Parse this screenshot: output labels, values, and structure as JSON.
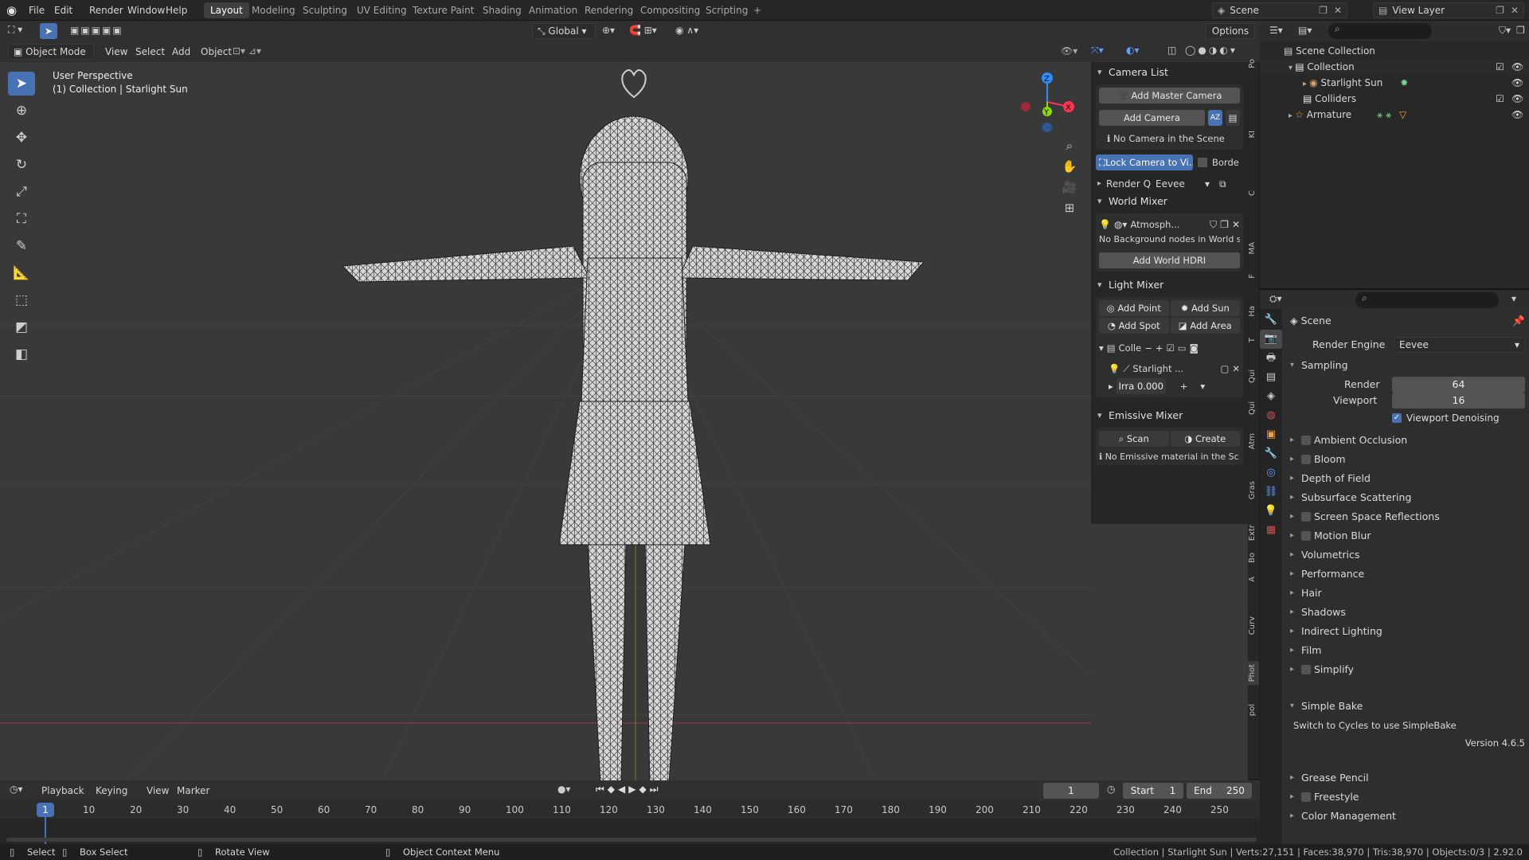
{
  "topbar": {
    "menus": [
      "File",
      "Edit",
      "Render",
      "Window",
      "Help"
    ],
    "workspaces": [
      "Layout",
      "Modeling",
      "Sculpting",
      "UV Editing",
      "Texture Paint",
      "Shading",
      "Animation",
      "Rendering",
      "Compositing",
      "Scripting"
    ],
    "active_workspace": "Layout",
    "scene_name": "Scene",
    "view_layer": "View Layer"
  },
  "toolheader": {
    "transform_orientation": "Global",
    "options_label": "Options"
  },
  "viewport_header": {
    "mode": "Object Mode",
    "menus": [
      "View",
      "Select",
      "Add",
      "Object"
    ]
  },
  "viewport": {
    "perspective_label": "User Perspective",
    "collection_label": "(1) Collection | Starlight Sun",
    "gizmo_axes": {
      "x": "X",
      "y": "Y",
      "z": "Z"
    }
  },
  "npanel": {
    "camera_list": {
      "title": "Camera List",
      "add_master": "Add Master Camera",
      "add_camera": "Add Camera",
      "sort_label": "AZ",
      "no_camera": "No Camera in the Scene",
      "lock_camera": "Lock Camera to Vi...",
      "border": "Borde"
    },
    "render_q": {
      "label": "Render Q",
      "value": "Eevee"
    },
    "world_mixer": {
      "title": "World Mixer",
      "world_name": "Atmosph...",
      "no_bg": "No Background nodes in World sh...",
      "add_hdri": "Add World HDRI"
    },
    "light_mixer": {
      "title": "Light Mixer",
      "add_point": "Add Point",
      "add_sun": "Add Sun",
      "add_spot": "Add Spot",
      "add_area": "Add Area",
      "collection": "Colle",
      "light_name": "Starlight ...",
      "irradiance_label": "Irra",
      "irradiance_value": "0.000"
    },
    "emissive_mixer": {
      "title": "Emissive Mixer",
      "scan": "Scan",
      "create": "Create",
      "no_emissive": "No Emissive material in the Sc..."
    }
  },
  "vertical_tabs": [
    "Po",
    "KI",
    "C",
    "MA",
    "F",
    "Ha",
    "T",
    "Qui",
    "Qui",
    "Atm",
    "Gras",
    "Extr",
    "Bo",
    "A",
    "Curv",
    "Phot",
    "pol"
  ],
  "outliner": {
    "root": "Scene Collection",
    "items": [
      {
        "label": "Collection",
        "level": 1
      },
      {
        "label": "Starlight Sun",
        "level": 2
      },
      {
        "label": "Colliders",
        "level": 1
      },
      {
        "label": "Armature",
        "level": 1
      }
    ]
  },
  "properties": {
    "scene_label": "Scene",
    "render_engine_label": "Render Engine",
    "render_engine_value": "Eevee",
    "sampling": {
      "title": "Sampling",
      "render_label": "Render",
      "render_value": "64",
      "viewport_label": "Viewport",
      "viewport_value": "16",
      "denoise_label": "Viewport Denoising"
    },
    "panels": [
      {
        "label": "Ambient Occlusion",
        "checkbox": true
      },
      {
        "label": "Bloom",
        "checkbox": true
      },
      {
        "label": "Depth of Field",
        "checkbox": false
      },
      {
        "label": "Subsurface Scattering",
        "checkbox": false
      },
      {
        "label": "Screen Space Reflections",
        "checkbox": true
      },
      {
        "label": "Motion Blur",
        "checkbox": true
      },
      {
        "label": "Volumetrics",
        "checkbox": false
      },
      {
        "label": "Performance",
        "checkbox": false
      },
      {
        "label": "Hair",
        "checkbox": false
      },
      {
        "label": "Shadows",
        "checkbox": false
      },
      {
        "label": "Indirect Lighting",
        "checkbox": false
      },
      {
        "label": "Film",
        "checkbox": false
      },
      {
        "label": "Simplify",
        "checkbox": true
      }
    ],
    "simple_bake": {
      "title": "Simple Bake",
      "note": "Switch to Cycles to use SimpleBake",
      "version": "Version 4.6.5"
    },
    "bottom_panels": [
      {
        "label": "Grease Pencil",
        "checkbox": false
      },
      {
        "label": "Freestyle",
        "checkbox": true
      },
      {
        "label": "Color Management",
        "checkbox": false
      }
    ]
  },
  "timeline": {
    "menus": [
      "Playback",
      "Keying",
      "View",
      "Marker"
    ],
    "current_frame": "1",
    "start_label": "Start",
    "start_value": "1",
    "end_label": "End",
    "end_value": "250",
    "ticks": [
      "10",
      "20",
      "30",
      "40",
      "50",
      "60",
      "70",
      "80",
      "90",
      "100",
      "110",
      "120",
      "130",
      "140",
      "150",
      "160",
      "170",
      "180",
      "190",
      "200",
      "210",
      "220",
      "230",
      "240",
      "250"
    ]
  },
  "statusbar": {
    "select": "Select",
    "box_select": "Box Select",
    "rotate_view": "Rotate View",
    "context_menu": "Object Context Menu",
    "stats": "Collection | Starlight Sun | Verts:27,151 | Faces:38,970 | Tris:38,970 | Objects:0/3 | 2.92.0"
  },
  "colors": {
    "accent": "#4772b3",
    "viewport_bg": "#393939",
    "panel_bg": "#2e2e2e",
    "x_axis": "#ff3352",
    "y_axis": "#8bdc00",
    "z_axis": "#2890ff"
  }
}
